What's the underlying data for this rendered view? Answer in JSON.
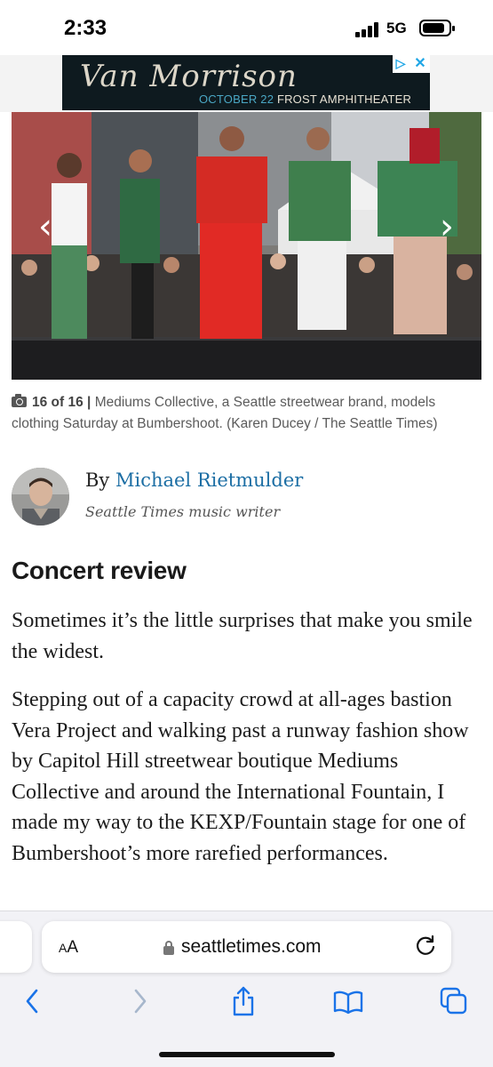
{
  "status_bar": {
    "time": "2:33",
    "network": "5G"
  },
  "ad": {
    "title": "Van Morrison",
    "date": "OCTOBER 22",
    "venue": "FROST AMPHITHEATER",
    "badge_play": "▷",
    "badge_close": "✕"
  },
  "photo": {
    "description_icons": [
      "chevron-left-icon",
      "chevron-right-icon"
    ],
    "prev_glyph": "‹",
    "next_glyph": "›"
  },
  "caption": {
    "count": "16 of 16",
    "separator": "|",
    "text": "Mediums Collective, a Seattle streetwear brand, models clothing Saturday at Bumbershoot. (Karen Ducey / The Seattle Times)"
  },
  "byline": {
    "prefix": "By",
    "author": "Michael Rietmulder",
    "role": "Seattle Times music writer"
  },
  "article": {
    "kicker": "Concert review",
    "paragraphs": [
      "Sometimes it’s the little surprises that make you smile the widest.",
      "Stepping out of a capacity crowd at all-ages bastion Vera Project and walking past a runway fashion show by Capitol Hill streetwear boutique Mediums Collective and around the International Fountain, I made my way to the KEXP/Fountain stage for one of Bumbershoot’s more rarefied performances."
    ]
  },
  "browser": {
    "text_size_label_small": "A",
    "text_size_label_large": "A",
    "url": "seattletimes.com",
    "accent": "#1a73e8"
  }
}
